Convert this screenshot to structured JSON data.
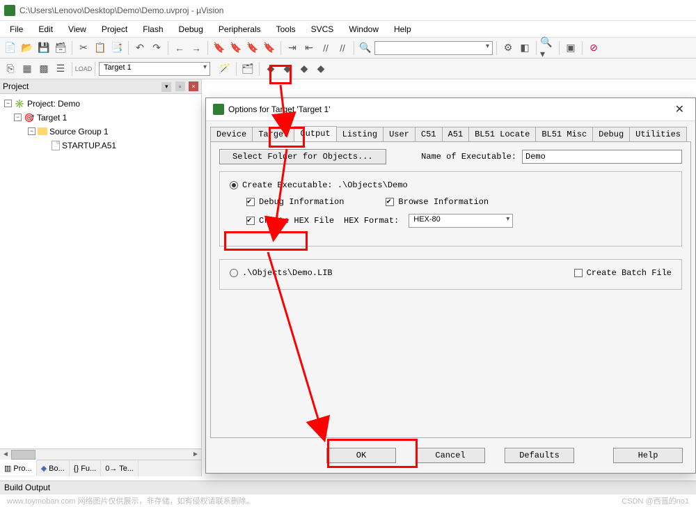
{
  "window": {
    "title": "C:\\Users\\Lenovo\\Desktop\\Demo\\Demo.uvproj - µVision"
  },
  "menus": [
    "File",
    "Edit",
    "View",
    "Project",
    "Flash",
    "Debug",
    "Peripherals",
    "Tools",
    "SVCS",
    "Window",
    "Help"
  ],
  "toolbar2": {
    "target_label": "Target 1"
  },
  "project_pane": {
    "title": "Project",
    "root": "Project: Demo",
    "target": "Target 1",
    "group": "Source Group 1",
    "file": "STARTUP.A51",
    "tabs": [
      "Pro...",
      "Bo...",
      "{} Fu...",
      "0→ Te..."
    ]
  },
  "dialog": {
    "title": "Options for Target 'Target 1'",
    "tabs": [
      "Device",
      "Target",
      "Output",
      "Listing",
      "User",
      "C51",
      "A51",
      "BL51 Locate",
      "BL51 Misc",
      "Debug",
      "Utilities"
    ],
    "active_tab": "Output",
    "select_folder_btn": "Select Folder for Objects...",
    "name_of_exe_label": "Name of Executable:",
    "exe_name": "Demo",
    "create_exe_label": "Create Executable:  .\\Objects\\Demo",
    "debug_info_label": "Debug Information",
    "browse_info_label": "Browse Information",
    "create_hex_label": "Create HEX File",
    "hex_format_label": "HEX Format:",
    "hex_format_value": "HEX-80",
    "create_lib_label": ".\\Objects\\Demo.LIB",
    "create_batch_label": "Create Batch File",
    "buttons": {
      "ok": "OK",
      "cancel": "Cancel",
      "defaults": "Defaults",
      "help": "Help"
    }
  },
  "build_output": "Build Output",
  "footer": {
    "left": "www.toymoban.com  网络图片仅供展示，非存储，如有侵权请联系删除。",
    "right": "CSDN @西晋的no1"
  }
}
